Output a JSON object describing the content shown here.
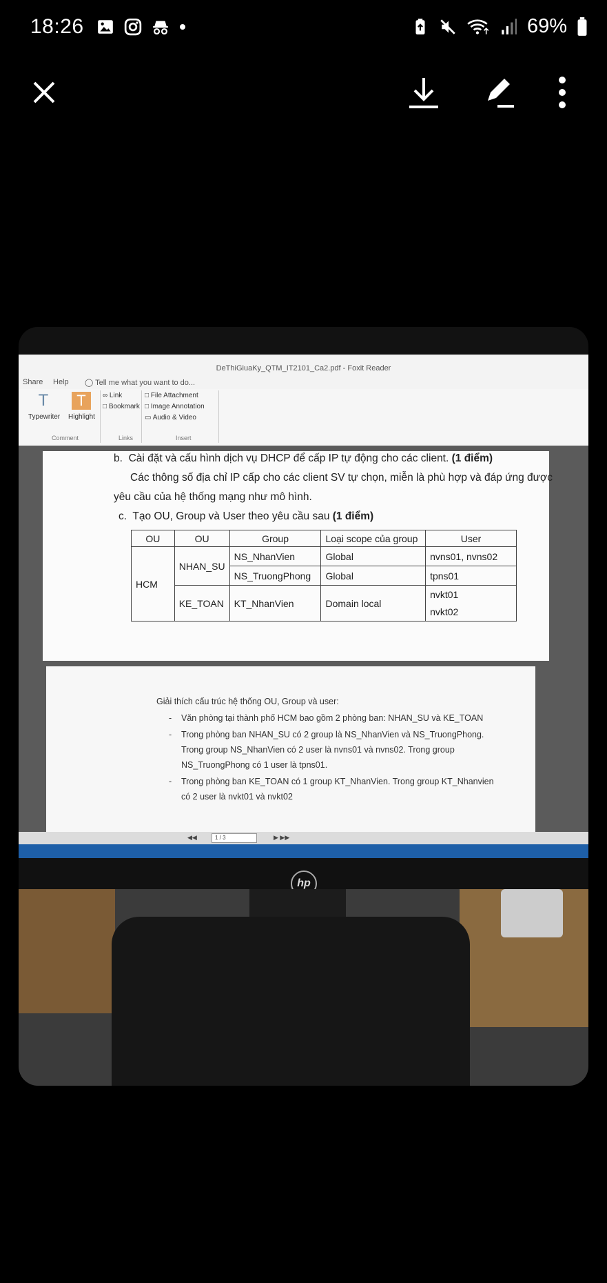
{
  "status_bar": {
    "time": "18:26",
    "battery": "69%",
    "left_icons": [
      "image-icon",
      "instagram-icon",
      "incognito-icon",
      "dot-icon"
    ],
    "right_icons": [
      "battery-saver-icon",
      "mute-icon",
      "wifi-icon",
      "signal-icon",
      "battery-icon"
    ]
  },
  "toolbar": {
    "close_icon": "close-icon",
    "download_icon": "download-icon",
    "edit_icon": "edit-icon",
    "more_icon": "more-vertical-icon"
  },
  "foxit": {
    "title": "DeThiGiuaKy_QTM_IT2101_Ca2.pdf - Foxit Reader",
    "tabs": [
      "Share",
      "Help"
    ],
    "tell_me": "Tell me what you want to do...",
    "comment_group": {
      "label": "Comment",
      "typewriter": "Typewriter",
      "highlight": "Highlight"
    },
    "links_group": {
      "label": "Links",
      "link": "Link",
      "bookmark": "Bookmark"
    },
    "insert_group": {
      "label": "Insert",
      "file_attachment": "File Attachment",
      "image_annotation": "Image Annotation",
      "audio_video": "Audio & Video"
    },
    "page_indicator": "1 / 3"
  },
  "document": {
    "item_b_prefix": "b.",
    "item_b_text": "Cài đặt và cấu hình dịch vụ DHCP để cấp IP tự động cho các client.",
    "item_b_points": "(1 điểm)",
    "para_line1": "Các thông số địa chỉ IP cấp cho các client SV tự chọn, miễn là phù hợp và đáp ứng được",
    "para_line2": "yêu cầu của hệ thống mạng như mô hình.",
    "item_c_prefix": "c.",
    "item_c_text": "Tạo OU, Group và User theo yêu cầu sau",
    "item_c_points": "(1 điểm)",
    "table": {
      "headers": [
        "OU",
        "OU",
        "Group",
        "Loại scope của group",
        "User"
      ],
      "ou1": "HCM",
      "ou2_a": "NHAN_SU",
      "ou2_b": "KE_TOAN",
      "rows": [
        {
          "group": "NS_NhanVien",
          "scope": "Global",
          "user": "nvns01, nvns02"
        },
        {
          "group": "NS_TruongPhong",
          "scope": "Global",
          "user": "tpns01"
        },
        {
          "group": "KT_NhanVien",
          "scope": "Domain local",
          "user_a": "nvkt01",
          "user_b": "nvkt02"
        }
      ]
    },
    "page2": {
      "heading": "Giải thích cấu trúc hệ thống OU, Group và user:",
      "b1": "Văn phòng tại thành phố HCM bao gồm 2 phòng ban: NHAN_SU và KE_TOAN",
      "b2_l1": "Trong phòng ban NHAN_SU có 2 group là NS_NhanVien và NS_TruongPhong.",
      "b2_l2": "Trong group NS_NhanVien có 2 user là nvns01 và nvns02. Trong group",
      "b2_l3": "NS_TruongPhong có 1 user là tpns01.",
      "b3_l1": "Trong phòng ban KE_TOAN có 1 group KT_NhanVien. Trong group KT_Nhanvien",
      "b3_l2": "có 2 user là nvkt01 và nvkt02"
    }
  },
  "monitor_logo": "hp"
}
